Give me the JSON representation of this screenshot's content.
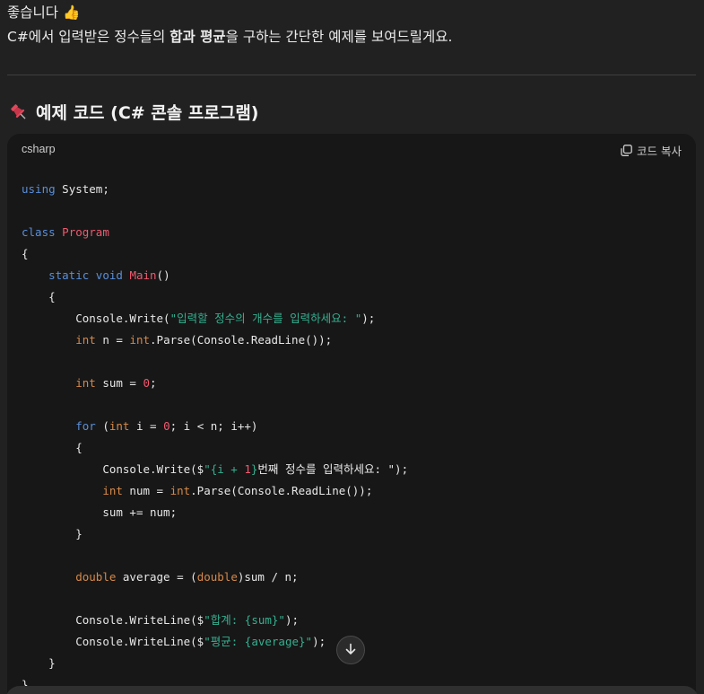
{
  "intro": {
    "line1": "좋습니다 👍",
    "line2_pre": "C#에서 입력받은 정수들의 ",
    "line2_bold": "합과 평균",
    "line2_post": "을 구하는 간단한 예제를 보여드릴게요."
  },
  "heading": {
    "icon": "pushpin-icon",
    "text": "예제 코드 (C# 콘솔 프로그램)"
  },
  "codeblock": {
    "language": "csharp",
    "copy_label": "코드 복사",
    "tokens": {
      "using": "using",
      "system": " System;",
      "class": "class",
      "program": "Program",
      "open_brace": "{",
      "close_brace": "}",
      "static": "static",
      "void": "void",
      "main": "Main",
      "parens": "()",
      "cw_prefix": "Console.Write(",
      "cw_str1": "\"입력할 정수의 개수를 입력하세요: \"",
      "cw_suffix": ");",
      "int": "int",
      "n_assign": " n = ",
      "parse_rl": ".Parse(Console.ReadLine());",
      "sum_assign": " sum = ",
      "zero": "0",
      "semicolon": ";",
      "for": "for",
      "for_open": " (",
      "i_assign": " i = ",
      "for_rest": "; i < n; i++)",
      "cw_interp_prefix": "Console.Write($",
      "interp_open": "\"{i + ",
      "one": "1",
      "interp_close": "}",
      "interp_text": "번째 정수를 입력하세요: \");",
      "num_assign": " num = ",
      "sum_add": "sum += num;",
      "double": "double",
      "avg_assign": " average = (",
      "avg_rest": ")sum / n;",
      "cwl_prefix": "Console.WriteLine($",
      "sum_str": "\"합계: {sum}\"",
      "avg_str": "\"평균: {average}\"",
      "cwl_suffix": ");"
    }
  },
  "scroll_button": {
    "icon": "arrow-down-icon"
  },
  "colors": {
    "background": "#212121",
    "code_background": "#171717",
    "keyword": "#5a8fd8",
    "type_keyword": "#d6894a",
    "class_name": "#ef5a6f",
    "string": "#35b08f"
  }
}
